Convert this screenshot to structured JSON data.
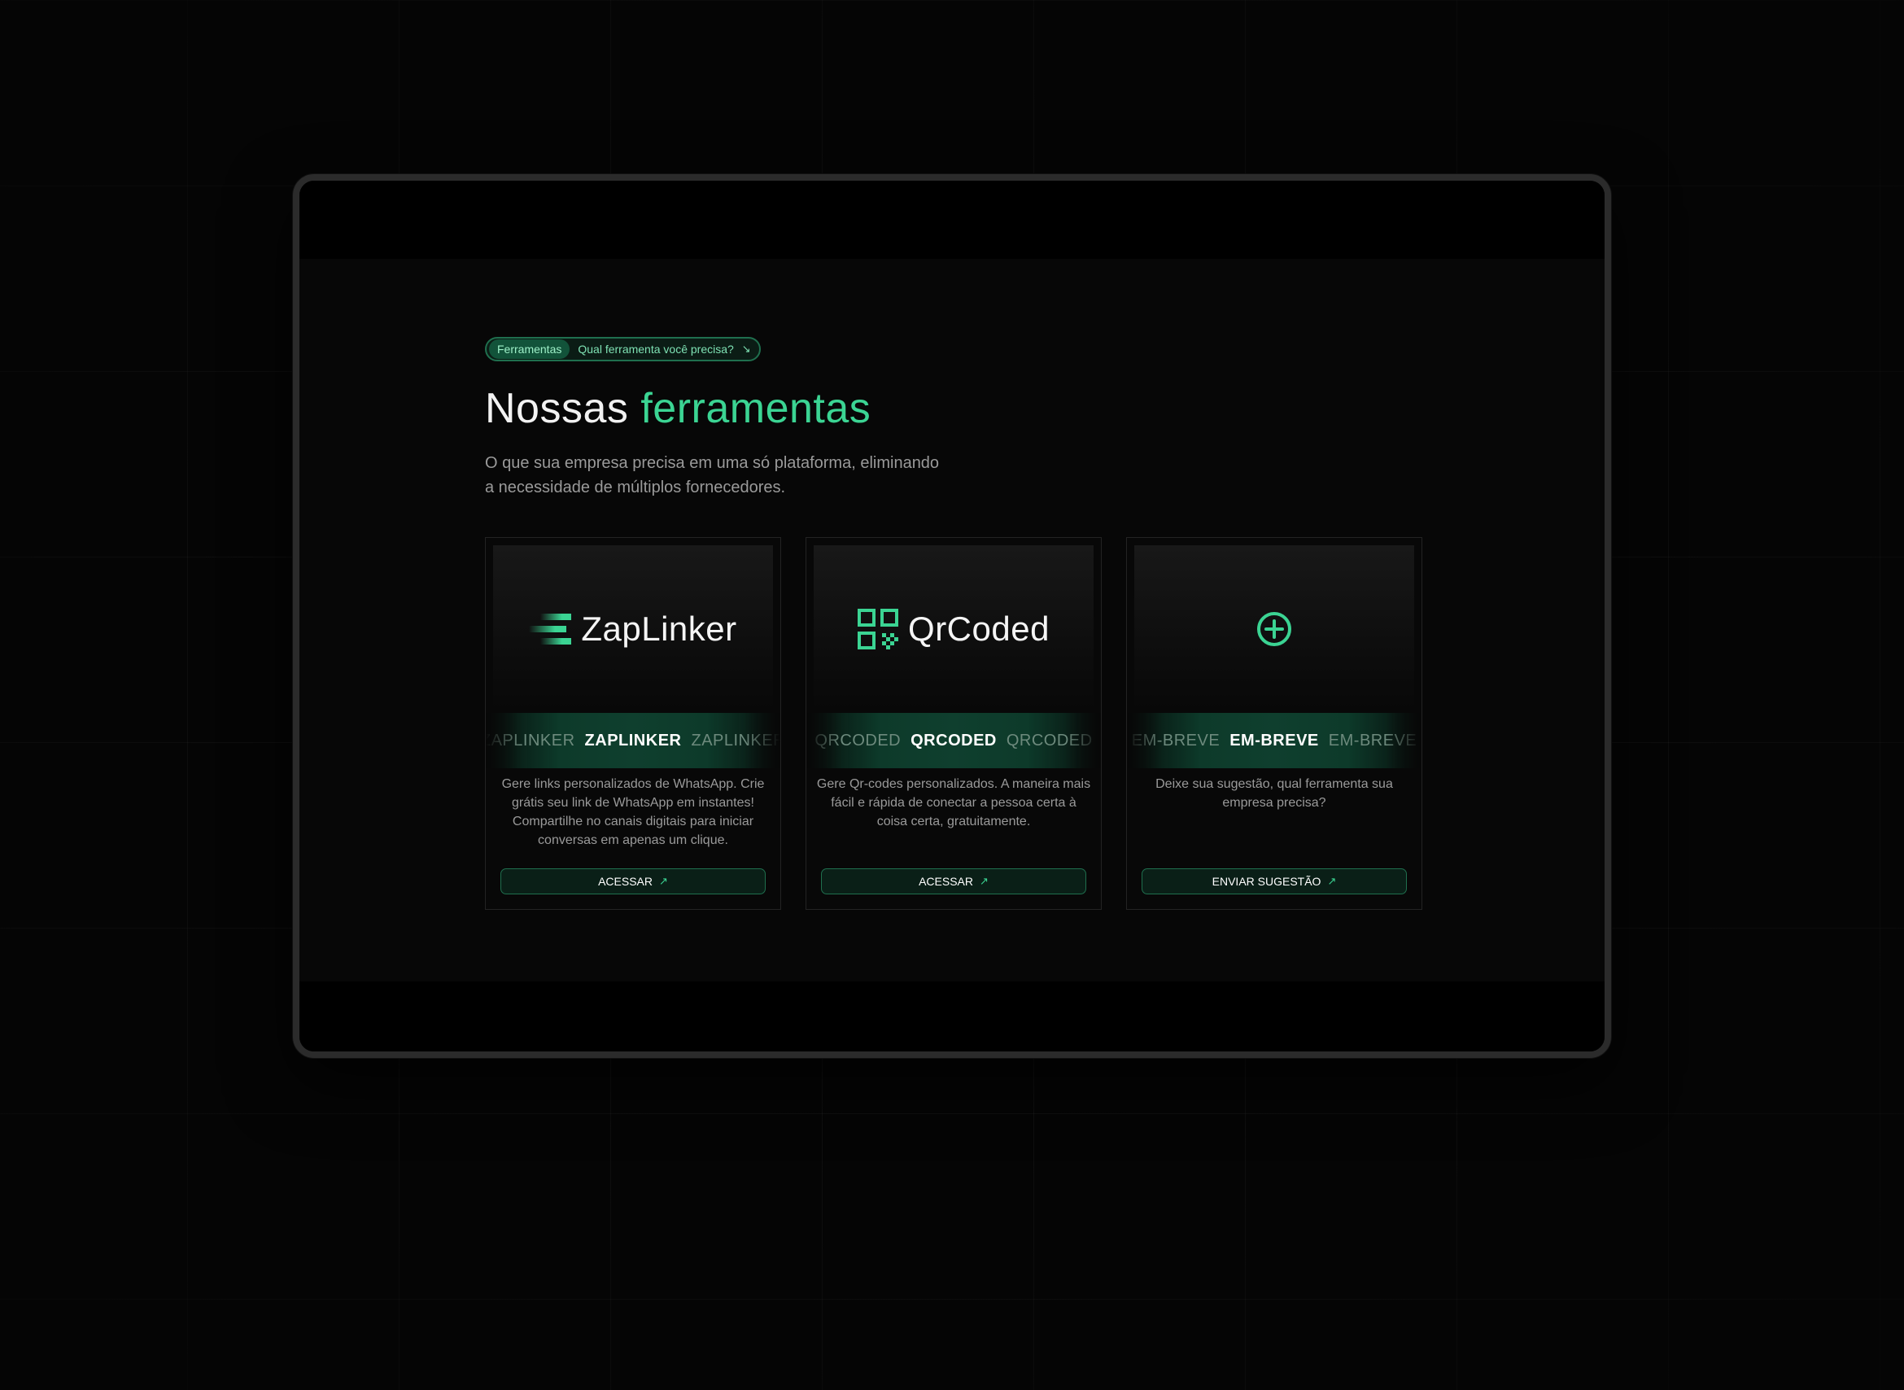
{
  "badge": {
    "tag": "Ferramentas",
    "text": "Qual ferramenta você precisa?",
    "arrow": "↘"
  },
  "heading": {
    "plain": "Nossas",
    "accent": "ferramentas"
  },
  "subtitle": "O que sua empresa precisa em uma só plataforma, eliminando a necessidade de múltiplos fornecedores.",
  "cards": [
    {
      "logo_text": "ZapLinker",
      "logo_icon": "zaplinker-bars-icon",
      "marquee": [
        "ZAPLINKER",
        "ZAPLINKER",
        "ZAPLINKER"
      ],
      "description": "Gere links personalizados de WhatsApp. Crie grátis seu link de WhatsApp em instantes! Compartilhe no canais digitais para iniciar conversas em apenas um clique.",
      "button": "ACESSAR",
      "button_arrow": "↗"
    },
    {
      "logo_text": "QrCoded",
      "logo_icon": "qrcode-icon",
      "marquee": [
        "QRCODED",
        "QRCODED",
        "QRCODED"
      ],
      "description": "Gere Qr-codes personalizados. A maneira mais fácil e rápida de conectar a pessoa certa à coisa certa, gratuitamente.",
      "button": "ACESSAR",
      "button_arrow": "↗"
    },
    {
      "logo_text": "",
      "logo_icon": "plus-circle-icon",
      "marquee": [
        "EM-BREVE",
        "EM-BREVE",
        "EM-BREVE"
      ],
      "description": "Deixe sua sugestão, qual ferramenta sua empresa precisa?",
      "button": "ENVIAR SUGESTÃO",
      "button_arrow": "↗"
    }
  ],
  "colors": {
    "accent": "#3bd493",
    "background": "#050505",
    "card_border": "#232323",
    "button_border": "#1f6f4e"
  }
}
